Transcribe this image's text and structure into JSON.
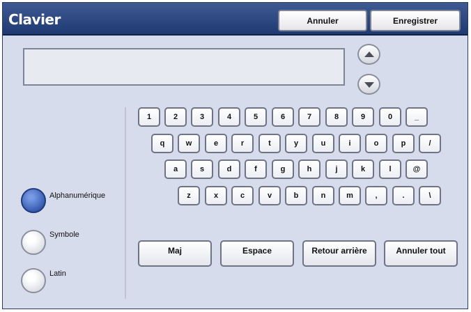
{
  "header": {
    "title": "Clavier",
    "cancel_label": "Annuler",
    "save_label": "Enregistrer"
  },
  "text_input": {
    "value": ""
  },
  "modes": [
    {
      "label": "Alphanumérique",
      "selected": true
    },
    {
      "label": "Symbole",
      "selected": false
    },
    {
      "label": "Latin",
      "selected": false
    }
  ],
  "keyboard": {
    "row1": [
      "1",
      "2",
      "3",
      "4",
      "5",
      "6",
      "7",
      "8",
      "9",
      "0",
      "_"
    ],
    "row2": [
      "q",
      "w",
      "e",
      "r",
      "t",
      "y",
      "u",
      "i",
      "o",
      "p",
      "/"
    ],
    "row3": [
      "a",
      "s",
      "d",
      "f",
      "g",
      "h",
      "j",
      "k",
      "l",
      "@"
    ],
    "row4": [
      "z",
      "x",
      "c",
      "v",
      "b",
      "n",
      "m",
      ",",
      ".",
      "\\"
    ]
  },
  "actions": {
    "shift_label": "Maj",
    "space_label": "Espace",
    "backspace_label": "Retour arrière",
    "clear_all_label": "Annuler tout"
  },
  "icons": {
    "scroll_up": "arrow-up-icon",
    "scroll_down": "arrow-down-icon"
  },
  "colors": {
    "title_bar": "#2a4680",
    "background": "#d7dcec",
    "radio_selected": "#2e52a8"
  }
}
